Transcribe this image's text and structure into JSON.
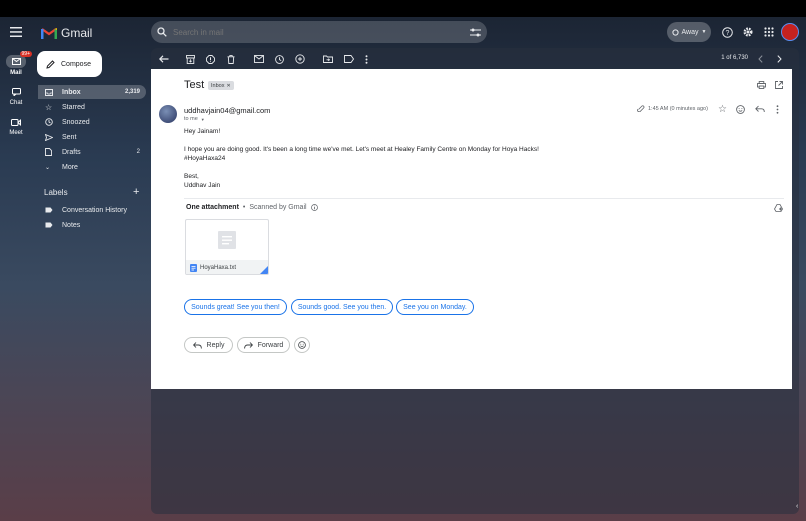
{
  "header": {
    "logo_text": "Gmail",
    "search_placeholder": "Search in mail",
    "status_label": "Away"
  },
  "rail": {
    "badge": "99+",
    "mail_label": "Mail",
    "chat_label": "Chat",
    "meet_label": "Meet"
  },
  "sidebar": {
    "compose_label": "Compose",
    "items": [
      {
        "label": "Inbox",
        "count": "2,319"
      },
      {
        "label": "Starred",
        "count": ""
      },
      {
        "label": "Snoozed",
        "count": ""
      },
      {
        "label": "Sent",
        "count": ""
      },
      {
        "label": "Drafts",
        "count": "2"
      },
      {
        "label": "More",
        "count": ""
      }
    ],
    "labels_heading": "Labels",
    "labels": [
      {
        "label": "Conversation History"
      },
      {
        "label": "Notes"
      }
    ]
  },
  "toolbar": {
    "pagination": "1 of 6,730"
  },
  "email": {
    "subject": "Test",
    "label_chip": "Inbox",
    "sender": "uddhavjain04@gmail.com",
    "to_line": "to me",
    "time": "1:45 AM (0 minutes ago)",
    "greeting": "Hey Jainam!",
    "body_line1": "I hope you are doing good. It's been a long time we've met. Let's meet at Healey Family Centre on Monday for Hoya Hacks!",
    "body_line2": "#HoyaHaxa24",
    "signoff": "Best,",
    "signature": "Uddhav Jain",
    "attachment_heading": "One attachment",
    "scan_note": "Scanned by Gmail",
    "attachment_name": "HoyaHaxa.txt",
    "smart_replies": [
      "Sounds great! See you then!",
      "Sounds good. See you then.",
      "See you on Monday."
    ],
    "reply_label": "Reply",
    "forward_label": "Forward"
  }
}
